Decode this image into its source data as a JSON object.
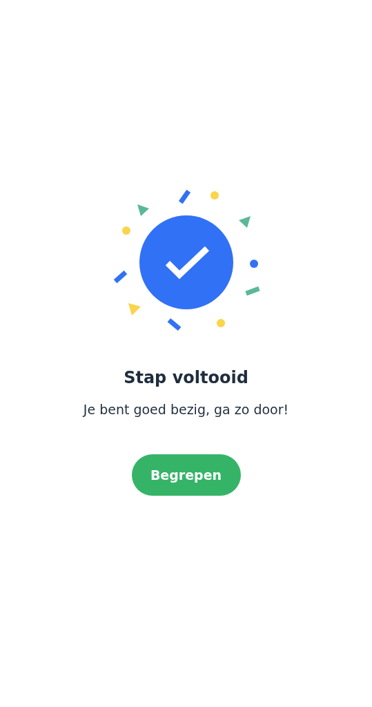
{
  "title": "Stap voltooid",
  "message": "Je bent goed bezig, ga zo door!",
  "button": {
    "label": "Begrepen"
  }
}
